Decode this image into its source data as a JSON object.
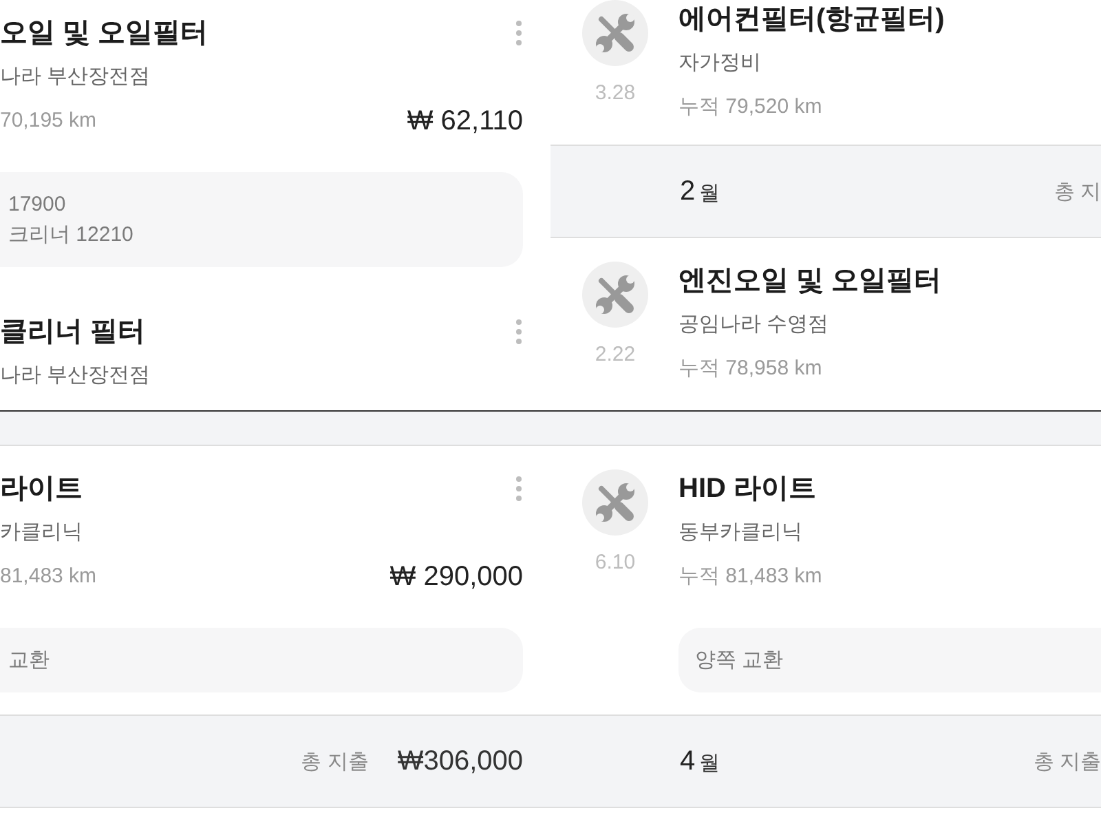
{
  "columns": [
    {
      "panels": [
        {
          "kind": "right",
          "items": [
            {
              "kind": "record",
              "title": "오일 및 오일필터",
              "shop": "나라 부산장전점",
              "mileage": "70,195 km",
              "price": "₩ 62,110",
              "memo": [
                "17900",
                "크리너 12210"
              ]
            },
            {
              "kind": "record",
              "title": "클리너 필터",
              "shop": "나라 부산장전점"
            }
          ]
        },
        {
          "kind": "right",
          "items": [
            {
              "kind": "month"
            },
            {
              "kind": "record",
              "title": "라이트",
              "shop": "카클리닉",
              "mileage": "81,483 km",
              "price": "₩ 290,000",
              "memo": [
                "교환"
              ]
            },
            {
              "kind": "month",
              "total_label": "총 지출",
              "total": "₩306,000"
            }
          ]
        }
      ]
    },
    {
      "panels": [
        {
          "kind": "left",
          "items": [
            {
              "kind": "record",
              "date": "3.28",
              "title": "에어컨필터(항균필터)",
              "shop": "자가정비",
              "mileage": "누적 79,520 km"
            },
            {
              "kind": "month",
              "month": "2",
              "unit": "월",
              "total_label": "총 지"
            },
            {
              "kind": "record",
              "date": "2.22",
              "title": "엔진오일 및 오일필터",
              "shop": "공임나라 수영점",
              "mileage": "누적 78,958 km"
            }
          ]
        },
        {
          "kind": "left",
          "items": [
            {
              "kind": "month"
            },
            {
              "kind": "record",
              "date": "6.10",
              "title": "HID 라이트",
              "shop": "동부카클리닉",
              "mileage": "누적 81,483 km",
              "memo": [
                "양쪽 교환"
              ]
            },
            {
              "kind": "month",
              "month": "4",
              "unit": "월",
              "total_label": "총 지출"
            }
          ]
        }
      ]
    }
  ]
}
